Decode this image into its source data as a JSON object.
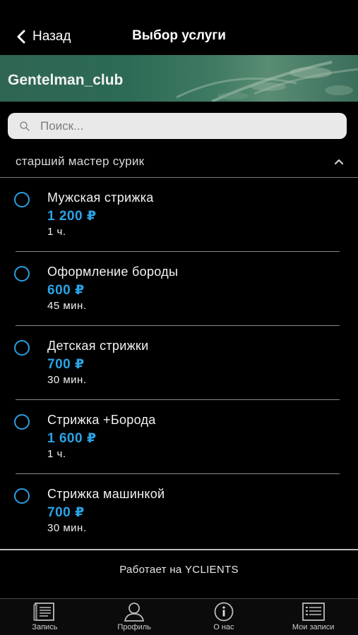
{
  "nav": {
    "back_label": "Назад",
    "title": "Выбор услуги"
  },
  "banner": {
    "brand": "Gentelman_club"
  },
  "search": {
    "placeholder": "Поиск..."
  },
  "category": {
    "label": "старший мастер сурик",
    "expanded": true
  },
  "services": [
    {
      "name": "Мужская стрижка",
      "price": "1 200 ₽",
      "duration": "1  ч."
    },
    {
      "name": "Оформление бороды",
      "price": "600 ₽",
      "duration": "45  мин."
    },
    {
      "name": "Детская стрижки",
      "price": "700 ₽",
      "duration": "30  мин."
    },
    {
      "name": "Стрижка +Борода",
      "price": "1 600 ₽",
      "duration": "1  ч."
    },
    {
      "name": "Стрижка машинкой",
      "price": "700 ₽",
      "duration": "30  мин."
    }
  ],
  "footer": {
    "powered_by": "Работает на YCLIENTS"
  },
  "tabs": [
    {
      "label": "Запись",
      "icon": "book-icon"
    },
    {
      "label": "Профиль",
      "icon": "profile-icon"
    },
    {
      "label": "О нас",
      "icon": "info-icon"
    },
    {
      "label": "Мои записи",
      "icon": "list-icon"
    }
  ],
  "colors": {
    "accent": "#2aa3e6",
    "background": "#000000",
    "banner": "#2f6653"
  }
}
